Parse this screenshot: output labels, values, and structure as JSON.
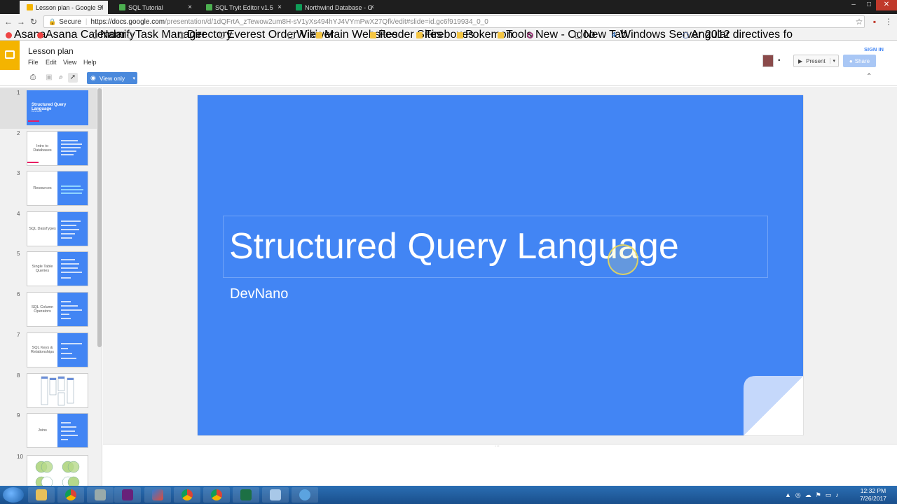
{
  "browser": {
    "tabs": [
      {
        "title": "Lesson plan - Google Sl",
        "active": true,
        "favicon_color": "#f4b400"
      },
      {
        "title": "SQL Tutorial",
        "active": false,
        "favicon_color": "#4caf50"
      },
      {
        "title": "SQL Tryit Editor v1.5",
        "active": false,
        "favicon_color": "#4caf50"
      },
      {
        "title": "Northwind Database - G",
        "active": false,
        "favicon_color": "#0f9d58"
      }
    ],
    "secure_label": "Secure",
    "url_host": "https://docs.google.com",
    "url_path": "/presentation/d/1dQFrtA_zTewow2um8H-sV1yXs494hYJ4VYmPwX27Qfk/edit#slide=id.gc6f919934_0_0",
    "bookmarks": [
      {
        "label": "Asana",
        "icon": "asana-icon"
      },
      {
        "label": "Asana Calendar",
        "icon": "asana-icon"
      },
      {
        "label": "Namify",
        "icon": "page-icon"
      },
      {
        "label": "Task Manager",
        "icon": "page-icon"
      },
      {
        "label": "Directory",
        "icon": "page-icon"
      },
      {
        "label": "Everest Order Viewer",
        "icon": "page-icon"
      },
      {
        "label": "Wiki",
        "icon": "doc-icon"
      },
      {
        "label": "Main Websites",
        "icon": "folder-icon"
      },
      {
        "label": "Feeder Sites",
        "icon": "folder-icon"
      },
      {
        "label": "Fireboxes",
        "icon": "folder-icon"
      },
      {
        "label": "Pokemon",
        "icon": "folder-icon"
      },
      {
        "label": "Tools",
        "icon": "folder-icon"
      },
      {
        "label": "New - Odoo",
        "icon": "odoo-icon"
      },
      {
        "label": "New Tab",
        "icon": "doc-icon"
      },
      {
        "label": "Windows Server 2012",
        "icon": "number-4-icon"
      },
      {
        "label": "Angular directives fo",
        "icon": "angular-icon"
      }
    ]
  },
  "slides_app": {
    "doc_title": "Lesson plan",
    "menu": [
      "File",
      "Edit",
      "View",
      "Help"
    ],
    "signin_label": "SIGN IN",
    "present_label": "Present",
    "share_label": "Share",
    "view_only_label": "View only"
  },
  "filmstrip": [
    {
      "num": "1",
      "title": "Structured Query Language",
      "sub": "DevNano",
      "layout": "full",
      "selected": true
    },
    {
      "num": "2",
      "title": "Intro to Databases",
      "layout": "split",
      "lines": 5
    },
    {
      "num": "3",
      "title": "Resources",
      "layout": "split",
      "lines": 3
    },
    {
      "num": "4",
      "title": "SQL DataTypes",
      "layout": "split",
      "lines": 5
    },
    {
      "num": "5",
      "title": "Single Table Queries",
      "layout": "split",
      "lines": 5
    },
    {
      "num": "6",
      "title": "SQL Column Operators",
      "layout": "split",
      "lines": 5
    },
    {
      "num": "7",
      "title": "SQL Keys & Relationships",
      "layout": "split",
      "lines": 4
    },
    {
      "num": "8",
      "title": "",
      "layout": "tables"
    },
    {
      "num": "9",
      "title": "Joins",
      "layout": "split",
      "lines": 5
    },
    {
      "num": "10",
      "title": "",
      "layout": "venn"
    }
  ],
  "slide": {
    "title": "Structured Query Language",
    "subtitle": "DevNano",
    "background": "#4285f4"
  },
  "taskbar": {
    "time": "12:32 PM",
    "date": "7/26/2017"
  }
}
